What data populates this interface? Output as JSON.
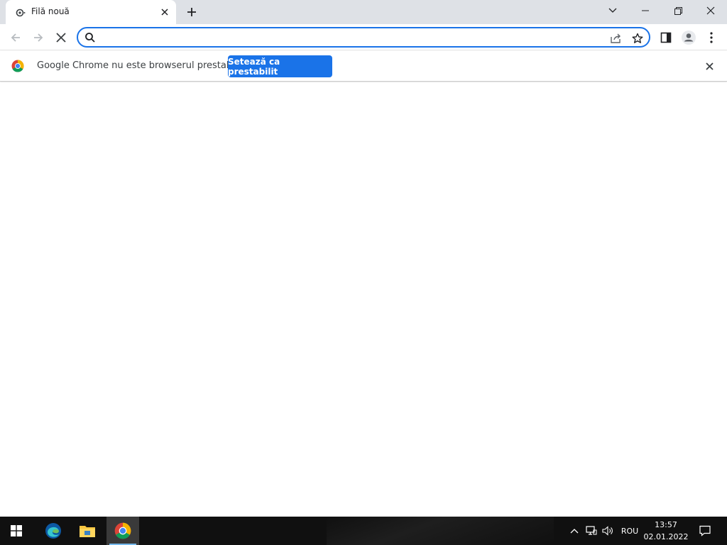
{
  "tab": {
    "title": "Filă nouă",
    "favicon": "incognito-like-tab-icon"
  },
  "window_controls": {
    "tab_search": "chevron-down-icon",
    "minimize": "minimize-icon",
    "restore": "restore-icon",
    "close": "close-icon"
  },
  "toolbar": {
    "back": "back-arrow-icon",
    "forward": "forward-arrow-icon",
    "stop": "stop-icon",
    "omnibox_value": "",
    "omnibox_placeholder": ""
  },
  "infobar": {
    "message": "Google Chrome nu este browserul prestabilit",
    "button_label": "Setează ca prestabilit"
  },
  "taskbar": {
    "language": "ROU",
    "time": "13:57",
    "date": "02.01.2022"
  },
  "colors": {
    "accent": "#1a73e8",
    "tabstrip": "#dee1e6",
    "taskbar": "#101010"
  }
}
